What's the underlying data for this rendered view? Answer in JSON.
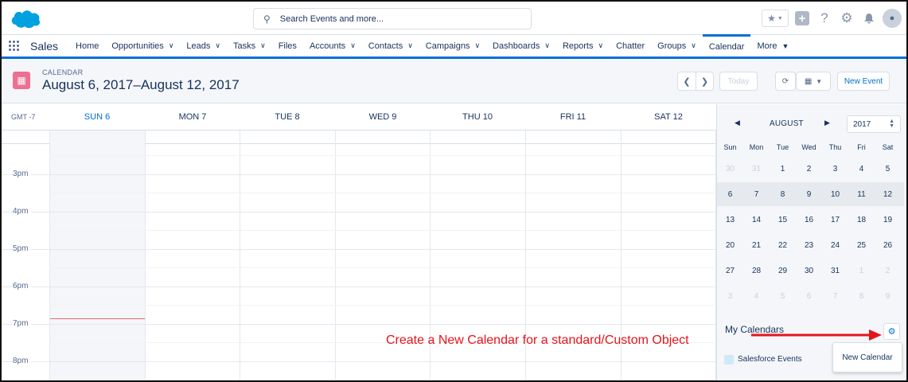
{
  "header": {
    "search_placeholder": "Search Events and more...",
    "icons": [
      "favorites-star-icon",
      "global-actions-plus-icon",
      "help-icon",
      "setup-gear-icon",
      "notifications-bell-icon",
      "user-avatar"
    ]
  },
  "nav": {
    "app_name": "Sales",
    "items": [
      {
        "label": "Home",
        "dropdown": false
      },
      {
        "label": "Opportunities",
        "dropdown": true
      },
      {
        "label": "Leads",
        "dropdown": true
      },
      {
        "label": "Tasks",
        "dropdown": true
      },
      {
        "label": "Files",
        "dropdown": false
      },
      {
        "label": "Accounts",
        "dropdown": true
      },
      {
        "label": "Contacts",
        "dropdown": true
      },
      {
        "label": "Campaigns",
        "dropdown": true
      },
      {
        "label": "Dashboards",
        "dropdown": true
      },
      {
        "label": "Reports",
        "dropdown": true
      },
      {
        "label": "Chatter",
        "dropdown": false
      },
      {
        "label": "Groups",
        "dropdown": true
      },
      {
        "label": "Calendar",
        "dropdown": false,
        "active": true
      }
    ],
    "more_label": "More"
  },
  "page": {
    "eyebrow": "CALENDAR",
    "title": "August 6, 2017–August 12, 2017",
    "today_label": "Today",
    "new_event_label": "New Event"
  },
  "calendar": {
    "timezone": "GMT -7",
    "days": [
      "SUN 6",
      "MON 7",
      "TUE 8",
      "WED 9",
      "THU 10",
      "FRI 11",
      "SAT 12"
    ],
    "today_index": 0,
    "hours": [
      "3pm",
      "4pm",
      "5pm",
      "6pm",
      "7pm",
      "8pm"
    ]
  },
  "mini_calendar": {
    "month": "AUGUST",
    "year": "2017",
    "weekdays": [
      "Sun",
      "Mon",
      "Tue",
      "Wed",
      "Thu",
      "Fri",
      "Sat"
    ],
    "weeks": [
      [
        "30",
        "31",
        "1",
        "2",
        "3",
        "4",
        "5"
      ],
      [
        "6",
        "7",
        "8",
        "9",
        "10",
        "11",
        "12"
      ],
      [
        "13",
        "14",
        "15",
        "16",
        "17",
        "18",
        "19"
      ],
      [
        "20",
        "21",
        "22",
        "23",
        "24",
        "25",
        "26"
      ],
      [
        "27",
        "28",
        "29",
        "30",
        "31",
        "1",
        "2"
      ],
      [
        "3",
        "4",
        "5",
        "6",
        "7",
        "8",
        "9"
      ]
    ],
    "selected_week": 1
  },
  "my_calendars": {
    "title": "My Calendars",
    "items": [
      "Salesforce Events"
    ],
    "new_calendar_label": "New Calendar"
  },
  "annotation": {
    "text": "Create a New Calendar for a standard/Custom Object"
  },
  "colors": {
    "brand_blue": "#0070d2",
    "calendar_icon": "#eb7092",
    "annotation_red": "#e5141b",
    "now_line": "#e06a72"
  }
}
